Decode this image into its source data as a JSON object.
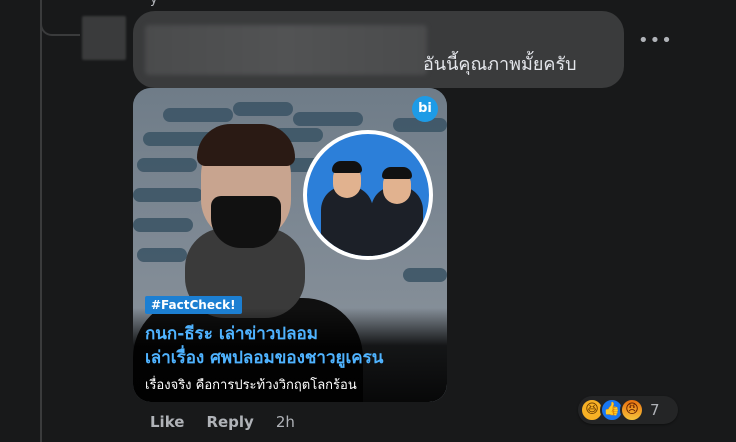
{
  "comment": {
    "top_fragment": "y",
    "text": "อันนี้คุณภาพมั้ยครับ",
    "more_label": "•••"
  },
  "image_card": {
    "logo": "bi",
    "tag": "#FactCheck!",
    "headline_line1": "กนก-ธีระ เล่าข่าวปลอม",
    "headline_line2": "เล่าเรื่อง ศพปลอมของชาวยูเครน",
    "subline": "เรื่องจริง คือการประท้วงวิกฤตโลกร้อน"
  },
  "actions": {
    "like": "Like",
    "reply": "Reply",
    "time": "2h"
  },
  "reactions": {
    "icons": [
      "haha-icon",
      "like-icon",
      "angry-icon"
    ],
    "count": "7"
  },
  "colors": {
    "background": "#18191a",
    "bubble": "#3a3b3c",
    "accent_blue": "#1877f2",
    "headline_blue": "#4fb3ff"
  }
}
